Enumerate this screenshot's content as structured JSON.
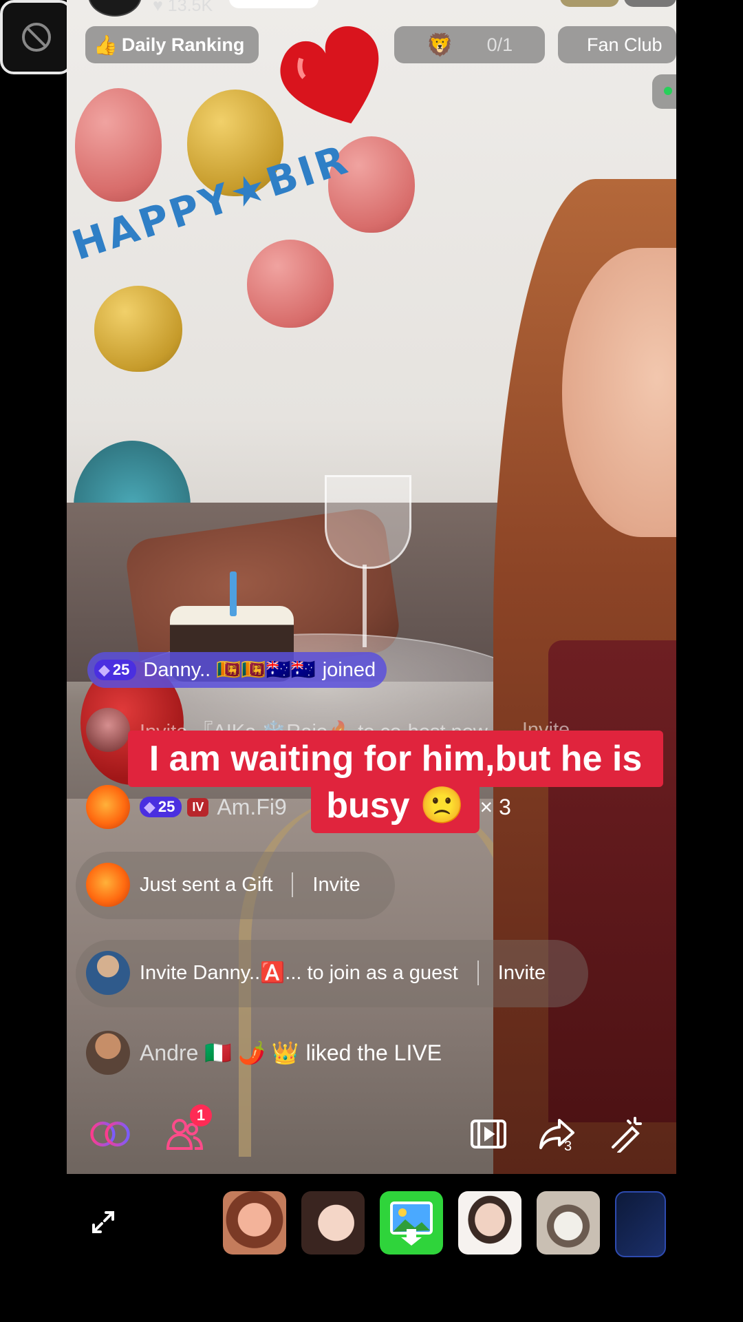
{
  "top": {
    "viewer_count": "13.5K"
  },
  "chips": {
    "daily_ranking": "Daily Ranking",
    "score": "0/1",
    "fan_club": "Fan Club"
  },
  "scene": {
    "banner_text": "HAPPY★BIR"
  },
  "feed": {
    "joined": {
      "level": "25",
      "name": "Danny.. 🇱🇰🇱🇰🇦🇺🇦🇺",
      "action": "joined"
    },
    "invite_cohost": {
      "text": "Invite 『AIKa ❄️Rajo🔥 to co-host now",
      "button": "Invite"
    },
    "gift_combo": {
      "level": "25",
      "fan_badge": "IV",
      "name": "Am.Fi9",
      "gift_suffix": "ss💋 × 3"
    },
    "gift": {
      "text": "Just sent a Gift",
      "button": "Invite"
    },
    "guest_invite": {
      "text": "Invite Danny..🅰️... to join as a guest",
      "button": "Invite"
    },
    "like": {
      "name": "Andre 🇮🇹 🌶️ 👑",
      "action": "liked the LIVE"
    }
  },
  "caption": {
    "line1": "I am waiting for him,but he is",
    "line2": "busy 🙁"
  },
  "bottom_bar": {
    "notification_count": "1",
    "share_count": "3",
    "icons": [
      "collab-icon",
      "guests-icon",
      "clip-icon",
      "share-icon",
      "magic-pen-icon"
    ]
  },
  "effects": {
    "items": [
      "expand-icon",
      "no-effect",
      "cartoon-girl",
      "beauty-face",
      "green-screen",
      "beard-man",
      "cat-face",
      "tech-frame"
    ]
  },
  "colors": {
    "caption_bg": "#e0243d",
    "joined_bg": "#5a50dc",
    "badge_bg": "#4a2fe0",
    "notification": "#ff2b55",
    "online_dot": "#28d05a"
  }
}
